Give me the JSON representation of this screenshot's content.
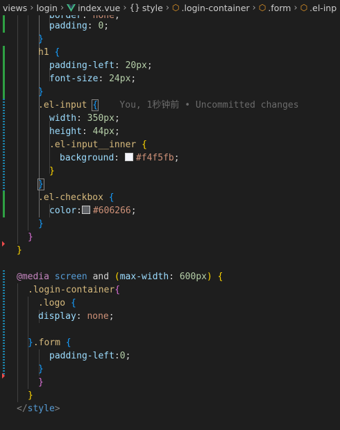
{
  "breadcrumb": {
    "items": [
      "views",
      "login",
      "index.vue",
      "style",
      ".login-container",
      ".form",
      ".el-inp"
    ]
  },
  "code": {
    "l0_prop": "border",
    "l0_val": "none",
    "l1_prop": "padding",
    "l1_val": "0",
    "l3_sel": "h1",
    "l4_prop": "padding-left",
    "l4_val": "20px",
    "l5_prop": "font-size",
    "l5_val": "24px",
    "l7_sel": ".el-input",
    "l7_blame": "You, 1秒钟前 • Uncommitted changes",
    "l8_prop": "width",
    "l8_val": "350px",
    "l9_prop": "height",
    "l9_val": "44px",
    "l10_sel": ".el-input__inner",
    "l11_prop": "background",
    "l11_val": "#f4f5fb",
    "l11_color": "#f4f5fb",
    "l14_sel": ".el-checkbox",
    "l15_prop": "color",
    "l15_val": "#606266",
    "l15_color": "#606266",
    "l20_at": "@media",
    "l20_screen": "screen",
    "l20_and": "and",
    "l20_prop": "max-width",
    "l20_val": "600px",
    "l21_sel": ".login-container",
    "l22_sel": ".logo",
    "l23_prop": "display",
    "l23_val": "none",
    "l25_sel": ".form",
    "l26_prop": "padding-left",
    "l26_val": "0",
    "l30_tag": "style"
  }
}
